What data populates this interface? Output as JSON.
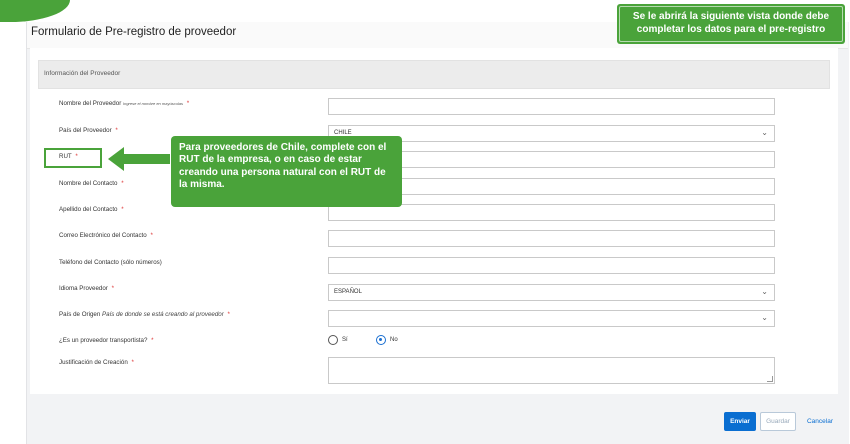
{
  "page": {
    "title": "Formulario de Pre-registro de proveedor",
    "section_title": "Información del Proveedor"
  },
  "fields": {
    "provider_name": {
      "label": "Nombre del Proveedor",
      "hint": "Ingrese el nombre en mayúsculas",
      "required": "*",
      "value": ""
    },
    "provider_country": {
      "label": "País del Proveedor",
      "required": "*",
      "value": "CHILE"
    },
    "rut": {
      "label": "RUT",
      "required": "*",
      "value": ""
    },
    "contact_name": {
      "label": "Nombre del Contacto",
      "required": "*",
      "value": ""
    },
    "contact_lastname": {
      "label": "Apellido del Contacto",
      "required": "*",
      "value": ""
    },
    "contact_email": {
      "label": "Correo Electrónico del Contacto",
      "required": "*",
      "value": ""
    },
    "contact_phone": {
      "label": "Teléfono del Contacto (sólo números)",
      "value": ""
    },
    "language": {
      "label": "Idioma Proveedor",
      "required": "*",
      "value": "ESPAÑOL"
    },
    "origin_country": {
      "label": "País de Origen",
      "hint": "País de donde se está creando al proveedor",
      "required": "*",
      "value": ""
    },
    "transport": {
      "label": "¿Es un proveedor transportista?",
      "required": "*",
      "option_yes": "Sí",
      "option_no": "No",
      "selected": "No"
    },
    "justification": {
      "label": "Justificación de Creación",
      "required": "*",
      "value": ""
    }
  },
  "buttons": {
    "send": "Enviar",
    "save": "Guardar",
    "cancel": "Cancelar"
  },
  "annotations": {
    "top_note": "Se le abrirá la siguiente vista donde debe completar los datos para el pre-registro",
    "rut_callout": "Para proveedores de Chile, complete con el RUT de la empresa, o en caso de estar creando una persona natural con el RUT de la misma."
  },
  "colors": {
    "annotation_green": "#4aa33a",
    "primary_blue": "#0a6ed1",
    "required_red": "#d33333"
  }
}
